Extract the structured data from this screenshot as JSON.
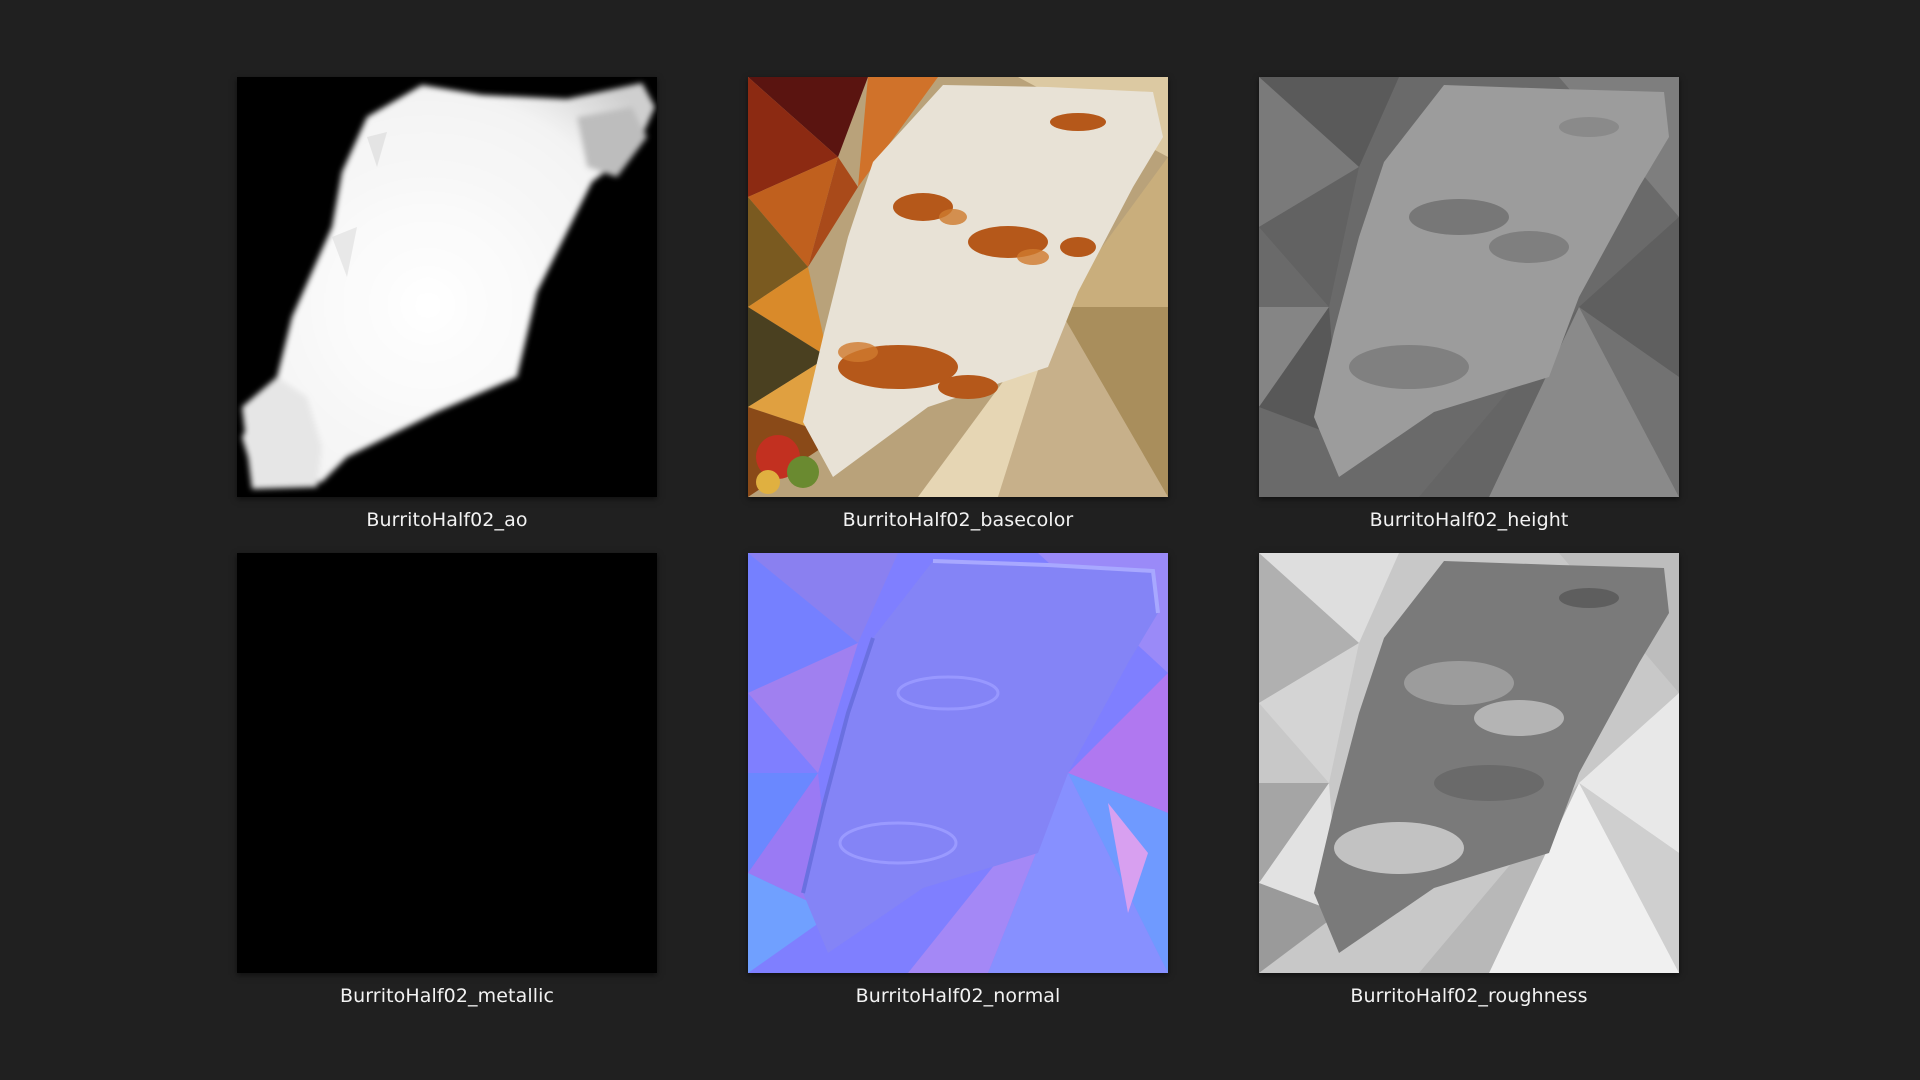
{
  "view": {
    "background": "#202020",
    "caption_color": "#f2f2f2"
  },
  "files": [
    {
      "name": "BurritoHalf02_ao",
      "map": "ambient-occlusion"
    },
    {
      "name": "BurritoHalf02_basecolor",
      "map": "base-color"
    },
    {
      "name": "BurritoHalf02_height",
      "map": "height"
    },
    {
      "name": "BurritoHalf02_metallic",
      "map": "metallic"
    },
    {
      "name": "BurritoHalf02_normal",
      "map": "normal"
    },
    {
      "name": "BurritoHalf02_roughness",
      "map": "roughness"
    }
  ]
}
